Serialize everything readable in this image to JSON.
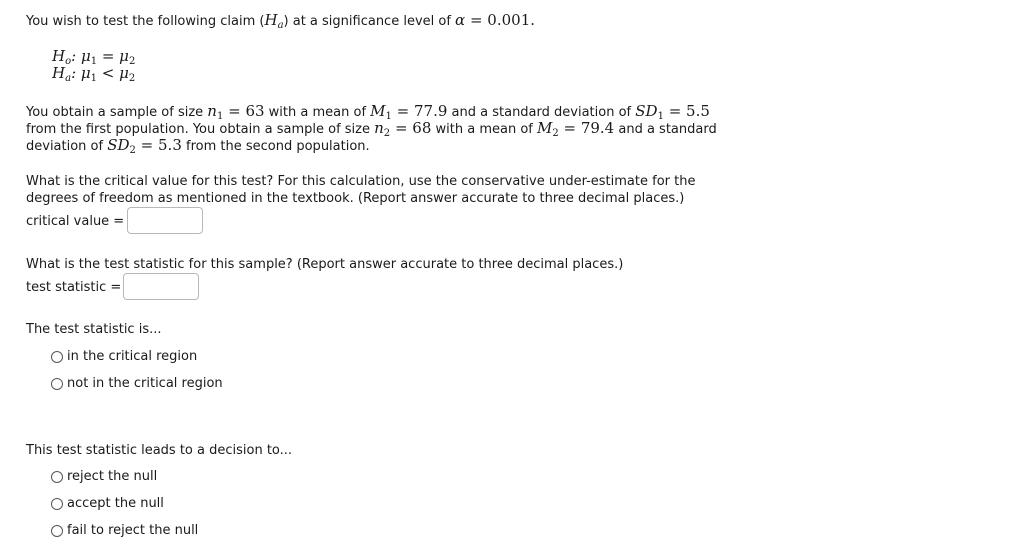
{
  "intro": {
    "text_before": "You wish to test the following claim (",
    "claim_symbol": "H",
    "claim_sub": "a",
    "text_middle": ") at a significance level of ",
    "alpha_symbol": "α",
    "alpha_eq": " = 0.001",
    "text_end": "."
  },
  "hypotheses": {
    "null": {
      "H": "H",
      "sub": "o",
      "rel": ": μ",
      "s1": "1",
      "op": " = μ",
      "s2": "2"
    },
    "alt": {
      "H": "H",
      "sub": "a",
      "rel": ": μ",
      "s1": "1",
      "op": " < μ",
      "s2": "2"
    }
  },
  "sample_info": {
    "line1": {
      "t1": "You obtain a sample of size ",
      "n1_sym": "n",
      "n1_sub": "1",
      "n1_val": " = 63",
      "t2": " with a mean of ",
      "m1_sym": "M",
      "m1_sub": "1",
      "m1_val": " = 77.9",
      "t3": " and a standard deviation of ",
      "sd1_sym": "SD",
      "sd1_sub": "1",
      "sd1_val": " = 5.5"
    },
    "line2": {
      "t1": "from the first population. You obtain a sample of size ",
      "n2_sym": "n",
      "n2_sub": "2",
      "n2_val": " = 68",
      "t2": " with a mean of ",
      "m2_sym": "M",
      "m2_sub": "2",
      "m2_val": " = 79.4",
      "t3": " and a standard"
    },
    "line3": {
      "t1": "deviation of ",
      "sd2_sym": "SD",
      "sd2_sub": "2",
      "sd2_val": " = 5.3",
      "t2": " from the second population."
    }
  },
  "critical_value_question": {
    "line1": "What is the critical value for this test? For this calculation, use the conservative under-estimate for the",
    "line2": "degrees of freedom as mentioned in the textbook. (Report answer accurate to three decimal places.)",
    "label": "critical value =",
    "value": ""
  },
  "test_statistic_question": {
    "line1": "What is the test statistic for this sample? (Report answer accurate to three decimal places.)",
    "label": "test statistic =",
    "value": ""
  },
  "region_question": {
    "prompt": "The test statistic is...",
    "options": [
      "in the critical region",
      "not in the critical region"
    ]
  },
  "decision_question": {
    "prompt": "This test statistic leads to a decision to...",
    "options": [
      "reject the null",
      "accept the null",
      "fail to reject the null"
    ]
  }
}
